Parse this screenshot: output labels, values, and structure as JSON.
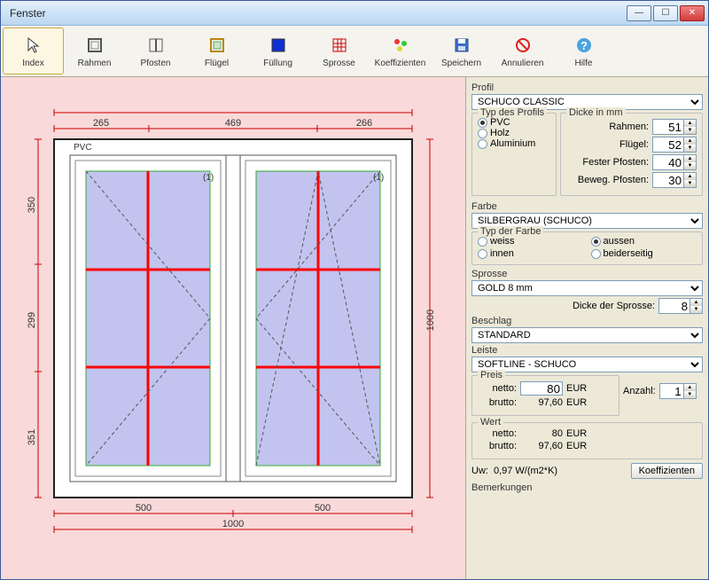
{
  "window": {
    "title": "Fenster"
  },
  "toolbar": {
    "items": [
      {
        "name": "index",
        "label": "Index"
      },
      {
        "name": "rahmen",
        "label": "Rahmen"
      },
      {
        "name": "pfosten",
        "label": "Pfosten"
      },
      {
        "name": "fluegel",
        "label": "Flügel"
      },
      {
        "name": "fuellung",
        "label": "Füllung"
      },
      {
        "name": "sprosse",
        "label": "Sprosse"
      },
      {
        "name": "koeff",
        "label": "Koeffizienten"
      },
      {
        "name": "speichern",
        "label": "Speichern"
      },
      {
        "name": "annulieren",
        "label": "Annulieren"
      },
      {
        "name": "hilfe",
        "label": "Hilfe"
      }
    ]
  },
  "drawing": {
    "material": "PVC",
    "pane_index_left": "(1)",
    "pane_index_right": "(1)",
    "dim_top_1": "265",
    "dim_top_2": "469",
    "dim_top_3": "266",
    "dim_bottom_1": "500",
    "dim_bottom_2": "500",
    "dim_bottom_total": "1000",
    "dim_left_1": "350",
    "dim_left_2": "299",
    "dim_left_3": "351",
    "dim_right": "1000"
  },
  "props": {
    "profile_label": "Profil",
    "profile_value": "SCHUCO CLASSIC",
    "profile_type_legend": "Typ des Profils",
    "profile_types": {
      "pvc": "PVC",
      "holz": "Holz",
      "alu": "Aluminium"
    },
    "profile_type_selected": "pvc",
    "thickness_legend": "Dicke in mm",
    "thickness": {
      "rahmen_label": "Rahmen:",
      "rahmen": "51",
      "fluegel_label": "Flügel:",
      "fluegel": "52",
      "fester_label": "Fester Pfosten:",
      "fester": "40",
      "beweg_label": "Beweg. Pfosten:",
      "beweg": "30"
    },
    "farbe_label": "Farbe",
    "farbe_value": "SILBERGRAU (SCHUCO)",
    "farbe_type_legend": "Typ der Farbe",
    "farbe_types": {
      "weiss": "weiss",
      "innen": "innen",
      "aussen": "aussen",
      "beider": "beiderseitig"
    },
    "farbe_type_selected": "aussen",
    "sprosse_label": "Sprosse",
    "sprosse_value": "GOLD 8 mm",
    "sprosse_thick_label": "Dicke der Sprosse:",
    "sprosse_thick": "8",
    "beschlag_label": "Beschlag",
    "beschlag_value": "STANDARD",
    "leiste_label": "Leiste",
    "leiste_value": "SOFTLINE - SCHUCO",
    "preis_legend": "Preis",
    "netto_label": "netto:",
    "netto": "80",
    "currency": "EUR",
    "brutto_label": "brutto:",
    "brutto": "97,60",
    "anzahl_label": "Anzahl:",
    "anzahl": "1",
    "wert_legend": "Wert",
    "wert_netto": "80",
    "wert_brutto": "97,60",
    "uw_label": "Uw:",
    "uw_value": "0,97 W/(m2*K)",
    "koeff_btn": "Koeffizienten",
    "bemerkungen_label": "Bemerkungen"
  }
}
